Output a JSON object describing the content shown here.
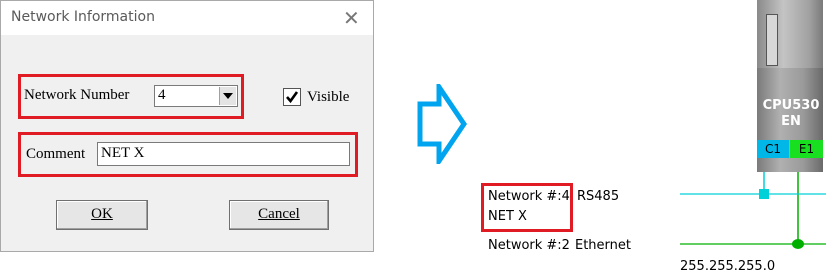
{
  "dialog": {
    "title": "Network Information",
    "network_number_label": "Network Number",
    "network_number_value": "4",
    "visible_label": "Visible",
    "visible_checked": true,
    "comment_label": "Comment",
    "comment_value": "NET X",
    "ok_label": "OK",
    "cancel_label": "Cancel"
  },
  "diagram": {
    "plc_model_line1": "CPU530",
    "plc_model_line2": "EN",
    "port_c1": "C1",
    "port_e1": "E1",
    "network_a_name": "Network #:4",
    "network_a_type": "RS485",
    "network_a_comment": "NET X",
    "network_b_name": "Network #:2",
    "network_b_type": "Ethernet",
    "subnet_mask": "255.255.255.0"
  },
  "colors": {
    "highlight": "#e01b24",
    "arrow": "#00a4ef",
    "rs485_line": "#00d0d8",
    "ethernet_line": "#00b000",
    "port_c1": "#00b7e8",
    "port_e1": "#18e020"
  }
}
